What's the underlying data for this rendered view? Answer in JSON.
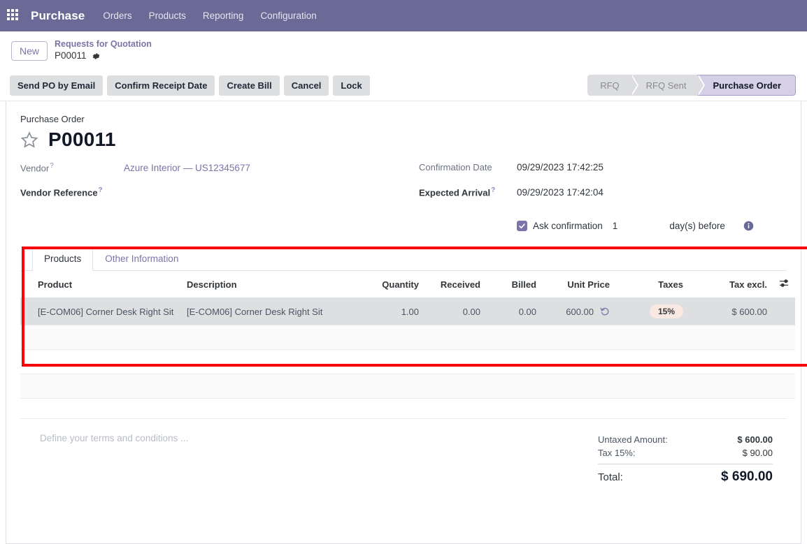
{
  "navbar": {
    "apps_icon": "apps-grid-icon",
    "brand": "Purchase",
    "menu": [
      {
        "label": "Orders"
      },
      {
        "label": "Products"
      },
      {
        "label": "Reporting"
      },
      {
        "label": "Configuration"
      }
    ],
    "background": "#6b6a96"
  },
  "breadcrumb": {
    "new_label": "New",
    "parent": "Requests for Quotation",
    "current": "P00011",
    "settings_icon": "gear-icon"
  },
  "control_bar": {
    "buttons": [
      {
        "label": "Send PO by Email"
      },
      {
        "label": "Confirm Receipt Date"
      },
      {
        "label": "Create Bill"
      },
      {
        "label": "Cancel"
      },
      {
        "label": "Lock"
      }
    ],
    "stages": [
      {
        "label": "RFQ",
        "active": false
      },
      {
        "label": "RFQ Sent",
        "active": false
      },
      {
        "label": "Purchase Order",
        "active": true
      }
    ],
    "active_stage_color": "#d6d0e6"
  },
  "form": {
    "type_label": "Purchase Order",
    "favorite_icon": "star-icon",
    "record_name": "P00011",
    "left_fields": [
      {
        "label": "Vendor",
        "help": "?",
        "value": "Azure Interior — US12345677",
        "is_link": true,
        "required": false
      },
      {
        "label": "Vendor Reference",
        "help": "?",
        "value": "",
        "is_link": false,
        "required": true
      }
    ],
    "right_fields": [
      {
        "label": "Confirmation Date",
        "help": "",
        "value": "09/29/2023 17:42:25",
        "required": false
      },
      {
        "label": "Expected Arrival",
        "help": "?",
        "value": "09/29/2023 17:42:04",
        "required": true
      }
    ],
    "ask_confirmation": {
      "checked": true,
      "label": "Ask confirmation",
      "days": "1",
      "unit": "day(s) before",
      "info_icon": "info-icon"
    }
  },
  "notebook": {
    "tabs": [
      {
        "label": "Products",
        "active": true
      },
      {
        "label": "Other Information",
        "active": false
      }
    ],
    "columns": [
      "Product",
      "Description",
      "Quantity",
      "Received",
      "Billed",
      "Unit Price",
      "Taxes",
      "Tax excl."
    ],
    "optional_columns_icon": "sliders-icon",
    "rows": [
      {
        "product": "[E-COM06] Corner Desk Right Sit",
        "description": "[E-COM06] Corner Desk Right Sit",
        "quantity": "1.00",
        "received": "0.00",
        "billed": "0.00",
        "unit_price": "600.00",
        "price_history_icon": "history-icon",
        "taxes": "15%",
        "tax_excl": "$ 600.00"
      }
    ]
  },
  "footer": {
    "terms_placeholder": "Define your terms and conditions ...",
    "totals": [
      {
        "label": "Untaxed Amount:",
        "value": "$ 600.00"
      },
      {
        "label": "Tax 15%:",
        "value": "$ 90.00"
      },
      {
        "label": "Total:",
        "value": "$ 690.00"
      }
    ]
  },
  "annotation": {
    "highlight_color": "#fb0007"
  }
}
